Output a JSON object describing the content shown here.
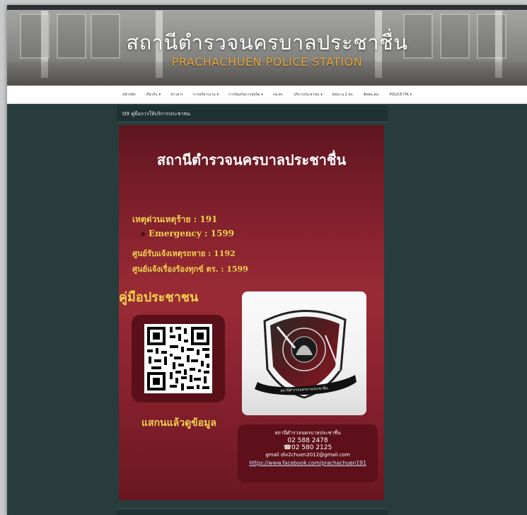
{
  "header": {
    "title": "สถานีตำรวจนครบาลประชาชื่น",
    "subtitle": "PRACHACHUEN POLICE STATION"
  },
  "nav": {
    "items": [
      {
        "label": "หน้าหลัก",
        "dropdown": false
      },
      {
        "label": "เกี่ยวกับ",
        "dropdown": true
      },
      {
        "label": "ข่าวสาร",
        "dropdown": false
      },
      {
        "label": "การบริหารงาน",
        "dropdown": true
      },
      {
        "label": "การป้องกันการทุจริต",
        "dropdown": true
      },
      {
        "label": "กต.ตร.",
        "dropdown": false
      },
      {
        "label": "บริการประชาชน",
        "dropdown": true
      },
      {
        "label": "ผังบก.น.2 ตร.",
        "dropdown": false
      },
      {
        "label": "ติดต่อ สน.",
        "dropdown": false
      },
      {
        "label": "POLICE ITA",
        "dropdown": true
      }
    ]
  },
  "breadcrumb": "O9 คู่มือการให้บริการประชาชน",
  "poster": {
    "title": "สถานีตำรวจนครบาลประชาชื่น",
    "hotlines": [
      "เหตุด่วนเหตุร้าย : 191",
      "Emergency : 1599",
      "ศูนย์รับแจ้งเหตุรถหาย : 1192",
      "ศูนย์แจ้งเรื่องร้องทุกข์ ตร. : 1599"
    ],
    "manual_title": "คู่มือประชาชน",
    "scan_text": "แสกนแล้วดูข้อมูล",
    "logo_ribbon": "สถานีตำรวจนครบาลประชาชื่น",
    "contact": {
      "name": "สถานีตำรวจนครบาลประชาชื่น",
      "phone1": "02 588 2478",
      "phone2": "☎02 580 2125",
      "email": "gmail div2chuen2012@gmail.com",
      "facebook": "https://www.facebook.com/prachachuen191"
    }
  },
  "colors": {
    "page_bg": "#283c3d",
    "poster_red": "#8c2330",
    "accent_gold": "#f2d24e",
    "subtitle_orange": "#e8a53a"
  }
}
